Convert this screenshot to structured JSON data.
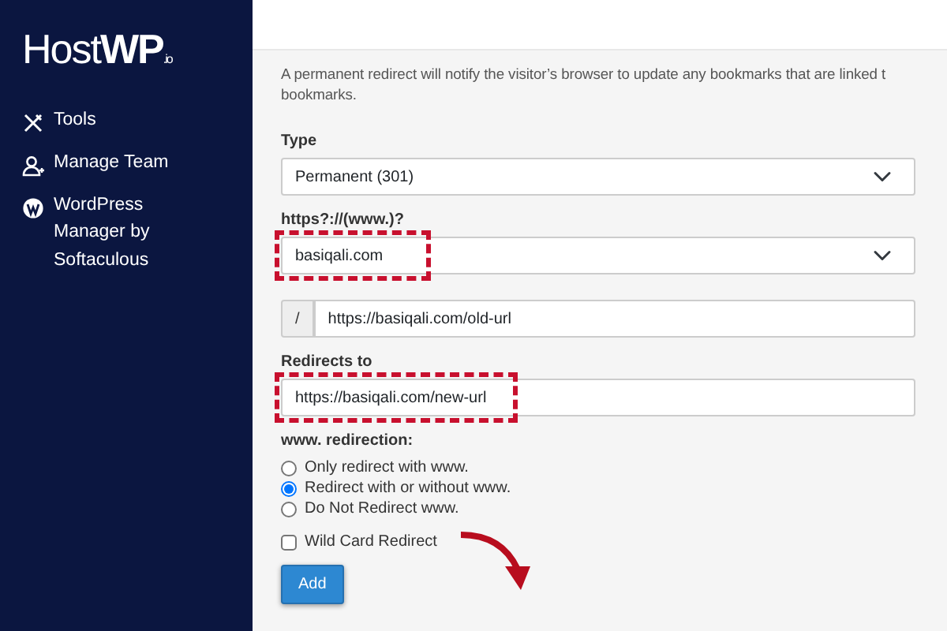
{
  "sidebar": {
    "logo": "Host**WP**$_{.io}$",
    "items": [
      {
        "label": "Tools"
      },
      {
        "label": "Manage Team"
      },
      {
        "label": "WordPress Manager by Softaculous"
      }
    ]
  },
  "description_lines": [
    "A permanent redirect will notify the visitor’s browser to update any bookmarks that are linked t",
    "bookmarks."
  ],
  "type": {
    "label": "Type",
    "value": "Permanent (301)"
  },
  "domain": {
    "label": "https?://(www.)?",
    "value": "basiqali.com",
    "highlighted": true
  },
  "path": {
    "prefix": "/",
    "value": "https://basiqali.com/old-url"
  },
  "redirect": {
    "label": "Redirects to",
    "value": "https://basiqali.com/new-url",
    "highlighted": true
  },
  "www_redirection": {
    "label": "www. redirection:",
    "options": [
      {
        "label": "Only redirect with www.",
        "selected": false
      },
      {
        "label": "Redirect with or without www.",
        "selected": true
      },
      {
        "label": "Do Not Redirect www.",
        "selected": false
      }
    ]
  },
  "wildcard": {
    "label": "Wild Card Redirect",
    "checked": false
  },
  "add_button": {
    "label": "Add",
    "pointed": true
  }
}
